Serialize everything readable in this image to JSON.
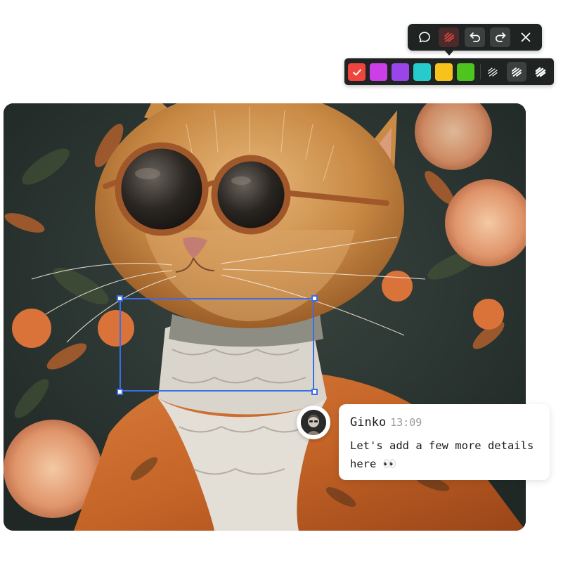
{
  "toolbar": {
    "tools": [
      {
        "name": "comment",
        "icon": "speech-bubble-icon",
        "active": false
      },
      {
        "name": "draw",
        "icon": "scribble-icon",
        "active": true,
        "color": "#e8483f"
      },
      {
        "name": "undo",
        "icon": "undo-icon",
        "active": false
      },
      {
        "name": "redo",
        "icon": "redo-icon",
        "active": false
      },
      {
        "name": "close",
        "icon": "close-icon",
        "active": false
      }
    ]
  },
  "palette": {
    "colors": [
      "#f0453f",
      "#cc3ee8",
      "#9a45ea",
      "#26cccc",
      "#f7c21b",
      "#4ec41e"
    ],
    "selected_color": "#f0453f",
    "strokes": [
      {
        "name": "thin",
        "icon": "stroke-thin-icon",
        "active": false
      },
      {
        "name": "medium",
        "icon": "stroke-medium-icon",
        "active": true
      },
      {
        "name": "thick",
        "icon": "stroke-thick-icon",
        "active": false
      }
    ]
  },
  "comment": {
    "author": "Ginko",
    "time": "13:09",
    "text": "Let's add a few more details here 👀"
  },
  "colors": {
    "selection": "#3a6ee8",
    "toolbar_bg": "#1f2321"
  }
}
